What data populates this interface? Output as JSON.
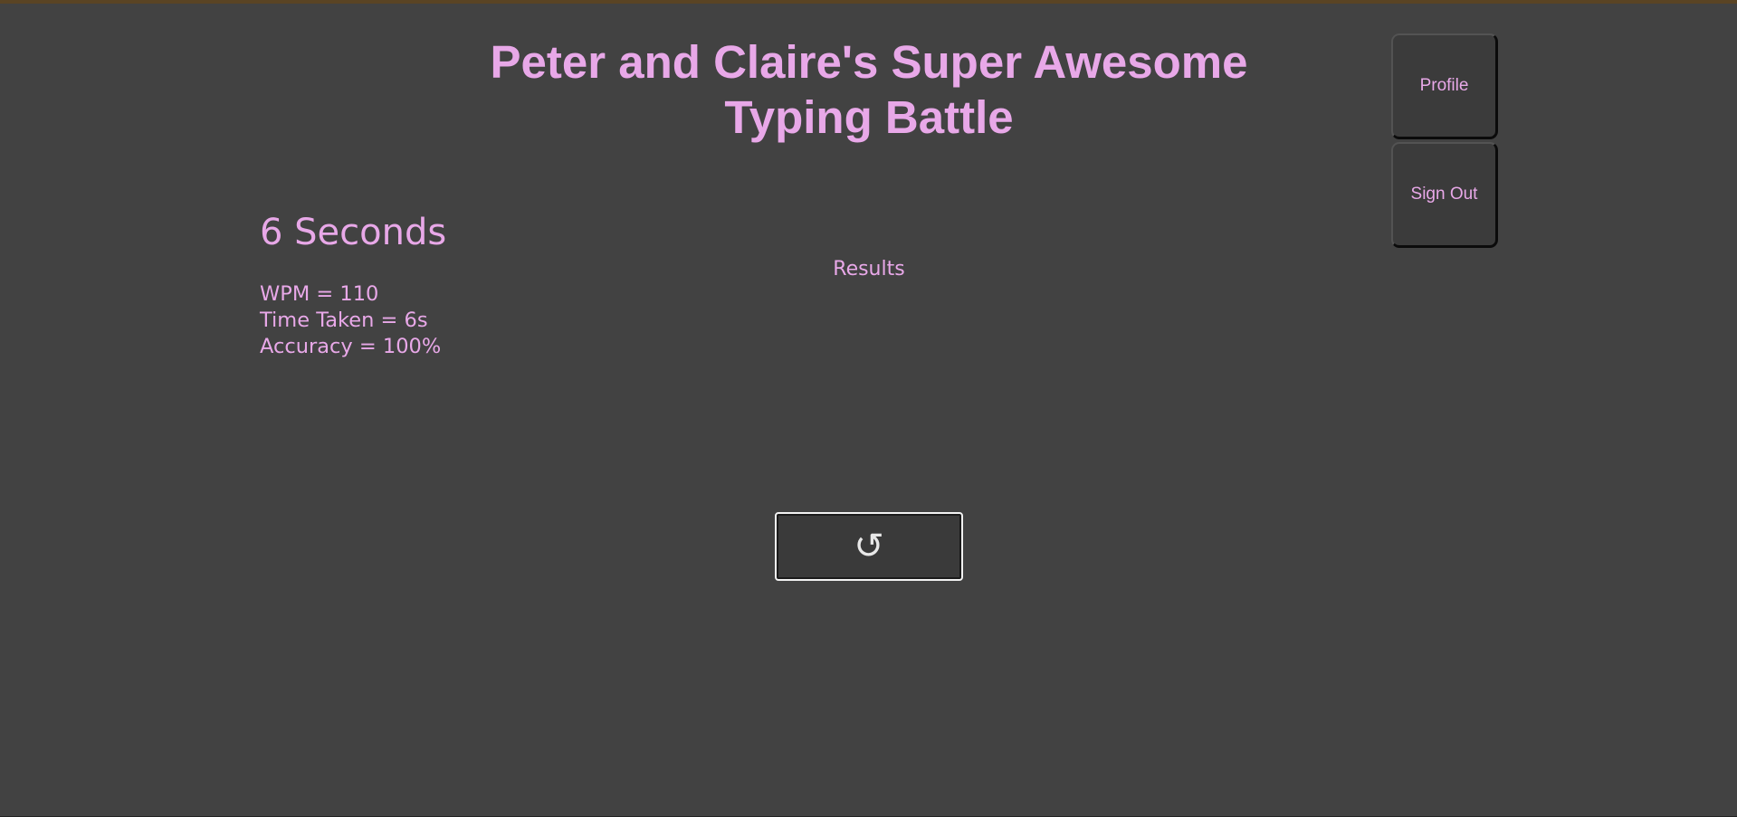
{
  "header": {
    "title_line1": "Peter and Claire's Super Awesome",
    "title_line2": "Typing Battle"
  },
  "nav": {
    "profile_label": "Profile",
    "signout_label": "Sign Out"
  },
  "timer": {
    "text": "6 Seconds"
  },
  "results": {
    "heading": "Results",
    "stats": [
      "WPM = 110",
      "Time Taken = 6s",
      "Accuracy = 100%"
    ]
  },
  "restart": {
    "icon": "restart-icon",
    "glyph": "↺"
  },
  "colors": {
    "background": "#424242",
    "accent_text": "#e8a8e8",
    "button_background": "#3b3b3b",
    "restart_border": "#f2f2f2"
  }
}
